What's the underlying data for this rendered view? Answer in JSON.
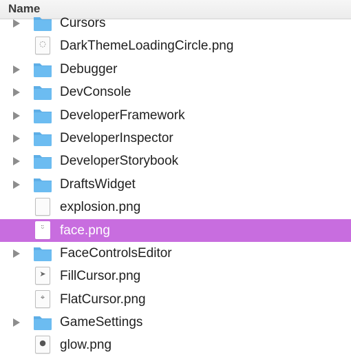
{
  "header": {
    "column_name": "Name"
  },
  "rows": [
    {
      "name": "Cursors",
      "kind": "folder",
      "expandable": true,
      "icon": "folder-icon"
    },
    {
      "name": "DarkThemeLoadingCircle.png",
      "kind": "file",
      "icon": "loading-circle-thumbnail-icon"
    },
    {
      "name": "Debugger",
      "kind": "folder",
      "expandable": true,
      "icon": "folder-icon"
    },
    {
      "name": "DevConsole",
      "kind": "folder",
      "expandable": true,
      "icon": "folder-icon"
    },
    {
      "name": "DeveloperFramework",
      "kind": "folder",
      "expandable": true,
      "icon": "folder-icon"
    },
    {
      "name": "DeveloperInspector",
      "kind": "folder",
      "expandable": true,
      "icon": "folder-icon"
    },
    {
      "name": "DeveloperStorybook",
      "kind": "folder",
      "expandable": true,
      "icon": "folder-icon"
    },
    {
      "name": "DraftsWidget",
      "kind": "folder",
      "expandable": true,
      "icon": "folder-icon"
    },
    {
      "name": "explosion.png",
      "kind": "file",
      "icon": "explosion-thumbnail-icon"
    },
    {
      "name": "face.png",
      "kind": "file",
      "selected": true,
      "icon": "face-thumbnail-icon"
    },
    {
      "name": "FaceControlsEditor",
      "kind": "folder",
      "expandable": true,
      "icon": "folder-icon"
    },
    {
      "name": "FillCursor.png",
      "kind": "file",
      "icon": "fill-cursor-thumbnail-icon"
    },
    {
      "name": "FlatCursor.png",
      "kind": "file",
      "icon": "flat-cursor-thumbnail-icon"
    },
    {
      "name": "GameSettings",
      "kind": "folder",
      "expandable": true,
      "icon": "folder-icon"
    },
    {
      "name": "glow.png",
      "kind": "file",
      "icon": "glow-thumbnail-icon"
    }
  ],
  "colors": {
    "selection": "#c86ddf",
    "folder": "#6cbcf1",
    "folder_tab": "#5eaee6",
    "disclosure": "#8d8d8d"
  }
}
